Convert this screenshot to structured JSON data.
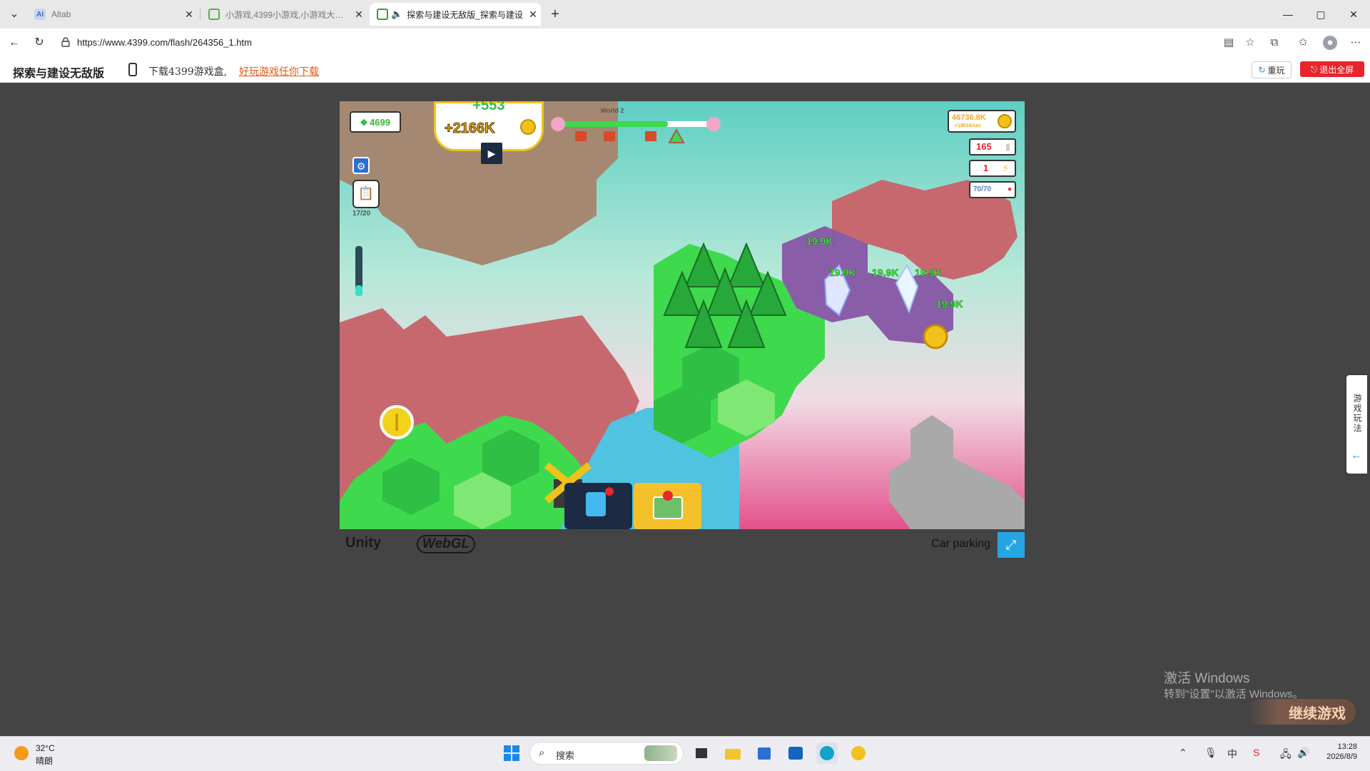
{
  "browser": {
    "tabs": [
      {
        "title": "Altab",
        "active": false
      },
      {
        "title": "小游戏,4399小游戏,小游戏大全,双",
        "active": false
      },
      {
        "title": "探索与建设无敌版_探索与建设",
        "active": true
      }
    ],
    "new_tab": "+",
    "window_controls": {
      "minimize": "—",
      "maximize": "▢",
      "close": "✕"
    },
    "url": "https://www.4399.com/flash/264356_1.htm"
  },
  "site_header": {
    "game_title": "探索与建设无敌版",
    "download_text": "下载4399游戏盒,",
    "download_link": "好玩游戏任你下载",
    "replay_label": "重玩",
    "exit_fullscreen_label": "退出全屏"
  },
  "game": {
    "gems": "4699",
    "coin_reward_top": "+553",
    "coin_reward": "+2166K",
    "world_label": "World 2",
    "coins_total": "46736.8K",
    "coins_rate": "+18616/sec",
    "stat_1": "165",
    "stat_2": "1",
    "stat_3": "70/70",
    "quest_progress": "17/20",
    "floating_values": [
      "19.9K",
      "19.9K",
      "19.9K",
      "19.9K",
      "19.9K"
    ],
    "colors": {
      "meadow": "#3fd94e",
      "desert": "#a58871",
      "rose": "#c7686f",
      "purple": "#8a5da8",
      "water": "#4fc3e0"
    }
  },
  "unity_bar": {
    "unity_label": "Unity",
    "webgl_label": "WebGL",
    "game_name": "Car parking",
    "fullscreen_icon": "⤢"
  },
  "side_tab": {
    "label": "游戏玩法",
    "arrow": "←"
  },
  "watermark": {
    "line1": "激活 Windows",
    "line2": "转到\"设置\"以激活 Windows。"
  },
  "continue_button": "继续游戏",
  "taskbar": {
    "temperature": "32°C",
    "weather": "晴朗",
    "search_placeholder": "搜索",
    "time": "13:28",
    "date": "2026/8/9"
  }
}
